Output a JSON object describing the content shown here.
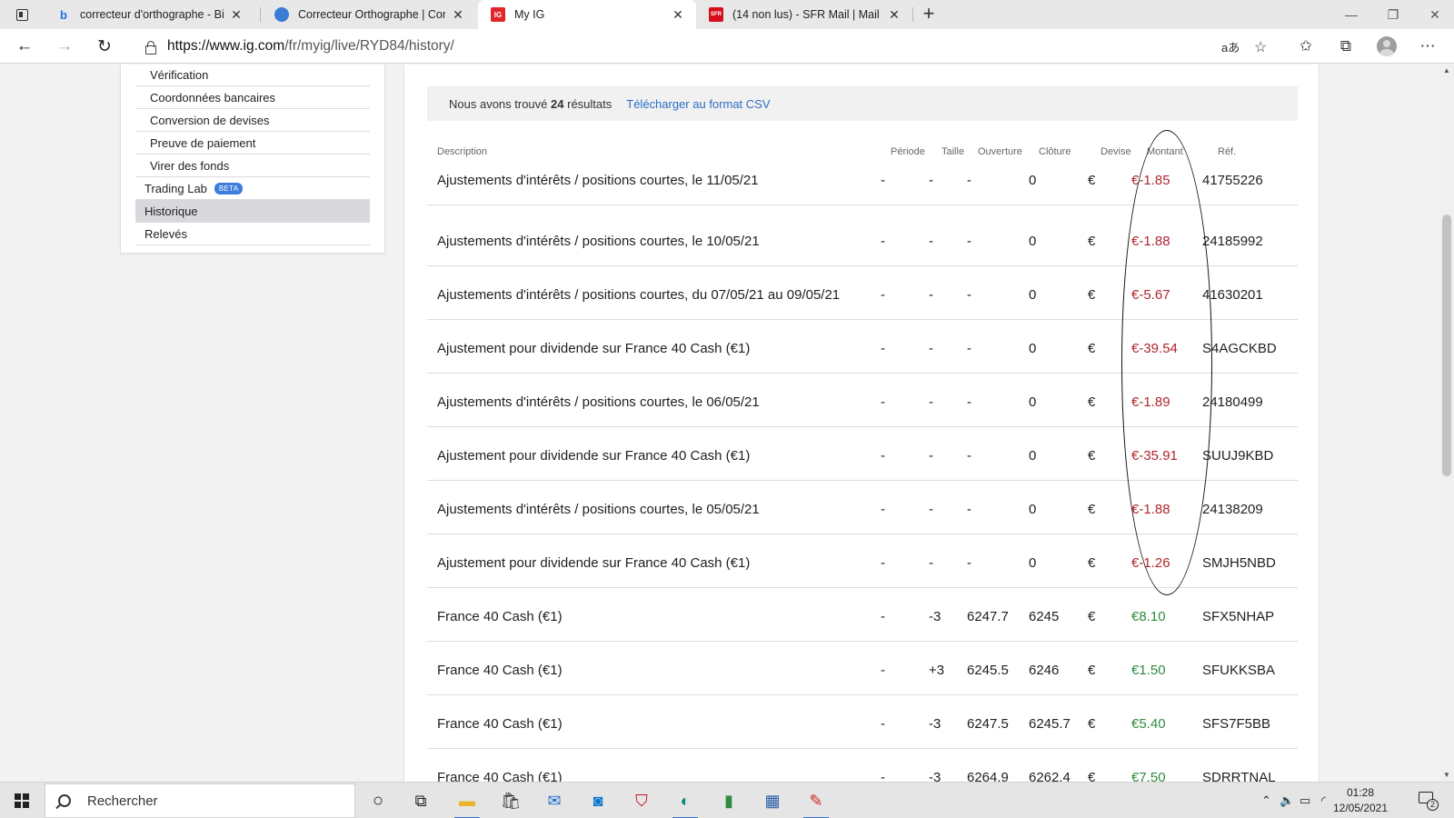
{
  "browser": {
    "tabs": [
      {
        "title": "correcteur d'orthographe - Bing",
        "icon": "bing-icon",
        "active": false
      },
      {
        "title": "Correcteur Orthographe | Correc",
        "icon": "globe-icon",
        "active": false
      },
      {
        "title": "My IG",
        "icon": "ig-logo-icon",
        "favicon_text": "IG",
        "active": true
      },
      {
        "title": "(14 non lus) - SFR Mail | Mail",
        "icon": "sfr-icon",
        "favicon_text": "SFR",
        "active": false
      }
    ],
    "url_host": "https://www.ig.com",
    "url_path": "/fr/myig/live/RYD84/history/"
  },
  "sidebar": {
    "items": [
      {
        "label": "Vérification"
      },
      {
        "label": "Coordonnées bancaires"
      },
      {
        "label": "Conversion de devises"
      },
      {
        "label": "Preuve de paiement"
      },
      {
        "label": "Virer des fonds"
      },
      {
        "label": "Trading Lab",
        "badge": "BETA"
      },
      {
        "label": "Historique",
        "active": true
      },
      {
        "label": "Relevés"
      }
    ]
  },
  "results": {
    "prefix": "Nous avons trouvé",
    "count": "24",
    "suffix": "résultats",
    "csv_link": "Télécharger au format CSV"
  },
  "table": {
    "columns": [
      "Description",
      "Période",
      "Taille",
      "Ouverture",
      "Clôture",
      "Devise",
      "Montant",
      "Réf."
    ],
    "rows": [
      {
        "description": "Ajustements d'intérêts / positions courtes, le 11/05/21",
        "periode": "-",
        "taille": "-",
        "ouverture": "-",
        "cloture": "0",
        "devise": "€",
        "montant": "€-1.85",
        "sign": "neg",
        "ref": "41755226"
      },
      {
        "description": "Ajustements d'intérêts / positions courtes, le 10/05/21",
        "periode": "-",
        "taille": "-",
        "ouverture": "-",
        "cloture": "0",
        "devise": "€",
        "montant": "€-1.88",
        "sign": "neg",
        "ref": "24185992"
      },
      {
        "description": "Ajustements d'intérêts / positions courtes, du 07/05/21 au 09/05/21",
        "periode": "-",
        "taille": "-",
        "ouverture": "-",
        "cloture": "0",
        "devise": "€",
        "montant": "€-5.67",
        "sign": "neg",
        "ref": "41630201"
      },
      {
        "description": "Ajustement pour dividende sur France 40 Cash (€1)",
        "periode": "-",
        "taille": "-",
        "ouverture": "-",
        "cloture": "0",
        "devise": "€",
        "montant": "€-39.54",
        "sign": "neg",
        "ref": "S4AGCKBD"
      },
      {
        "description": "Ajustements d'intérêts / positions courtes, le 06/05/21",
        "periode": "-",
        "taille": "-",
        "ouverture": "-",
        "cloture": "0",
        "devise": "€",
        "montant": "€-1.89",
        "sign": "neg",
        "ref": "24180499"
      },
      {
        "description": "Ajustement pour dividende sur France 40 Cash (€1)",
        "periode": "-",
        "taille": "-",
        "ouverture": "-",
        "cloture": "0",
        "devise": "€",
        "montant": "€-35.91",
        "sign": "neg",
        "ref": "SUUJ9KBD"
      },
      {
        "description": "Ajustements d'intérêts / positions courtes, le 05/05/21",
        "periode": "-",
        "taille": "-",
        "ouverture": "-",
        "cloture": "0",
        "devise": "€",
        "montant": "€-1.88",
        "sign": "neg",
        "ref": "24138209"
      },
      {
        "description": "Ajustement pour dividende sur France 40 Cash (€1)",
        "periode": "-",
        "taille": "-",
        "ouverture": "-",
        "cloture": "0",
        "devise": "€",
        "montant": "€-1.26",
        "sign": "neg",
        "ref": "SMJH5NBD"
      },
      {
        "description": "France 40 Cash (€1)",
        "periode": "-",
        "taille": "-3",
        "ouverture": "6247.7",
        "cloture": "6245",
        "devise": "€",
        "montant": "€8.10",
        "sign": "pos",
        "ref": "SFX5NHAP"
      },
      {
        "description": "France 40 Cash (€1)",
        "periode": "-",
        "taille": "+3",
        "ouverture": "6245.5",
        "cloture": "6246",
        "devise": "€",
        "montant": "€1.50",
        "sign": "pos",
        "ref": "SFUKKSBA"
      },
      {
        "description": "France 40 Cash (€1)",
        "periode": "-",
        "taille": "-3",
        "ouverture": "6247.5",
        "cloture": "6245.7",
        "devise": "€",
        "montant": "€5.40",
        "sign": "pos",
        "ref": "SFS7F5BB"
      },
      {
        "description": "France 40 Cash (€1)",
        "periode": "-",
        "taille": "-3",
        "ouverture": "6264.9",
        "cloture": "6262.4",
        "devise": "€",
        "montant": "€7.50",
        "sign": "pos",
        "ref": "SDRRTNAL"
      }
    ]
  },
  "colors": {
    "negative": "#b0262d",
    "positive": "#2e8b3e",
    "link": "#2c6dc4"
  },
  "taskbar": {
    "search_placeholder": "Rechercher",
    "time": "01:28",
    "date": "12/05/2021",
    "notification_count": "2"
  }
}
